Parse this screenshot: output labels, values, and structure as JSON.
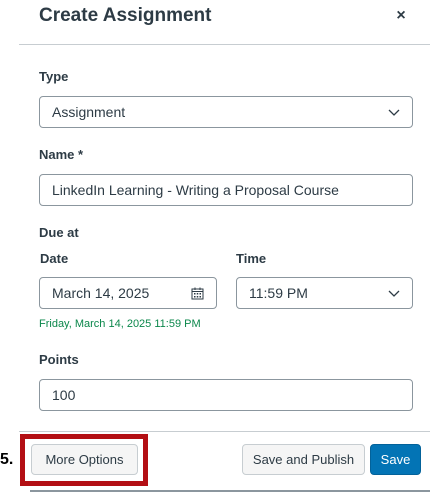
{
  "dialog": {
    "title": "Create Assignment",
    "close_symbol": "×"
  },
  "type": {
    "label": "Type",
    "value": "Assignment"
  },
  "name": {
    "label": "Name *",
    "value": "LinkedIn Learning - Writing a Proposal Course"
  },
  "due": {
    "label": "Due at",
    "date_label": "Date",
    "date_value": "March 14, 2025",
    "time_label": "Time",
    "time_value": "11:59 PM",
    "summary": "Friday, March 14, 2025 11:59 PM"
  },
  "points": {
    "label": "Points",
    "value": "100"
  },
  "footer": {
    "step_marker": "5.",
    "more_options": "More Options",
    "save_and_publish": "Save and Publish",
    "save": "Save"
  },
  "colors": {
    "accent": "#0374b5",
    "highlight": "#b30f14",
    "success_text": "#0b874b"
  },
  "icons": {
    "close": "close-icon",
    "type_dropdown": "chevron-down-icon",
    "calendar": "calendar-icon",
    "time_dropdown": "chevron-down-icon"
  }
}
